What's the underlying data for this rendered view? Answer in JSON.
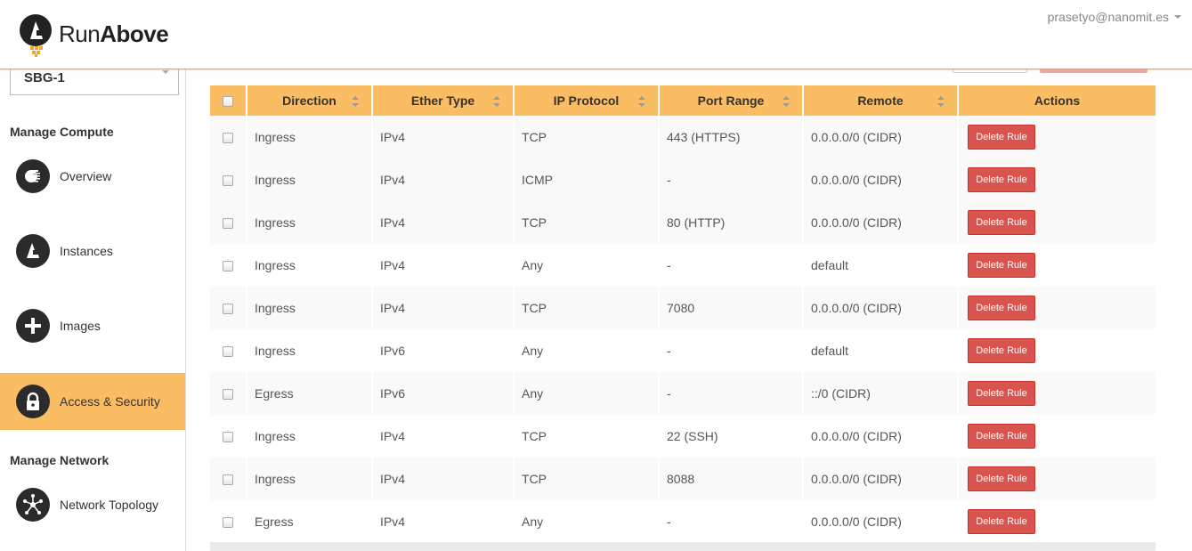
{
  "header": {
    "logo_text_regular": "Run",
    "logo_text_bold": "Above",
    "user_email": "prasetyo@nanomit.es"
  },
  "sidebar": {
    "region": "SBG-1",
    "section_compute": "Manage Compute",
    "section_network": "Manage Network",
    "items": [
      {
        "label": "Overview",
        "icon": "overview-icon"
      },
      {
        "label": "Instances",
        "icon": "instances-icon"
      },
      {
        "label": "Images",
        "icon": "plus-icon"
      },
      {
        "label": "Access & Security",
        "icon": "lock-icon",
        "active": true
      },
      {
        "label": "Network Topology",
        "icon": "network-topology-icon"
      }
    ]
  },
  "table": {
    "columns": [
      "Direction",
      "Ether Type",
      "IP Protocol",
      "Port Range",
      "Remote",
      "Actions"
    ],
    "delete_label": "Delete Rule",
    "rows": [
      [
        "Ingress",
        "IPv4",
        "TCP",
        "443 (HTTPS)",
        "0.0.0.0/0 (CIDR)"
      ],
      [
        "Ingress",
        "IPv4",
        "ICMP",
        "-",
        "0.0.0.0/0 (CIDR)"
      ],
      [
        "Ingress",
        "IPv4",
        "TCP",
        "80 (HTTP)",
        "0.0.0.0/0 (CIDR)"
      ],
      [
        "Ingress",
        "IPv4",
        "Any",
        "-",
        "default"
      ],
      [
        "Ingress",
        "IPv4",
        "TCP",
        "7080",
        "0.0.0.0/0 (CIDR)"
      ],
      [
        "Ingress",
        "IPv6",
        "Any",
        "-",
        "default"
      ],
      [
        "Egress",
        "IPv6",
        "Any",
        "-",
        "::/0 (CIDR)"
      ],
      [
        "Ingress",
        "IPv4",
        "TCP",
        "22 (SSH)",
        "0.0.0.0/0 (CIDR)"
      ],
      [
        "Ingress",
        "IPv4",
        "TCP",
        "8088",
        "0.0.0.0/0 (CIDR)"
      ],
      [
        "Egress",
        "IPv4",
        "Any",
        "-",
        "0.0.0.0/0 (CIDR)"
      ]
    ]
  },
  "colors": {
    "accent": "#fbbd63",
    "danger": "#d9534f",
    "dark_icon": "#2b2b2b"
  }
}
